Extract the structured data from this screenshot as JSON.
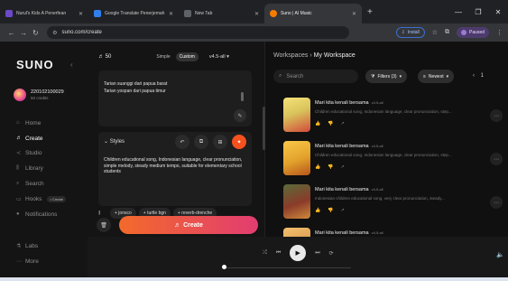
{
  "browser": {
    "tabs": [
      {
        "title": "Nurul's Kids A Penerfean",
        "fav": "#6b49c9"
      },
      {
        "title": "Google Translate Penerjemah g",
        "fav": "#2f80ed"
      },
      {
        "title": "New Tab",
        "fav": "#5f6368"
      },
      {
        "title": "Suno | AI Music",
        "fav": "#f57c00"
      }
    ],
    "new_tab": "+",
    "url": "suno.com/create",
    "install_label": "Install",
    "profile_label": "Paused"
  },
  "sidebar": {
    "logo": "SUNO",
    "user_name": "220102100029",
    "user_credits": "50 credits",
    "items": [
      {
        "label": "Home",
        "icon": "⌂"
      },
      {
        "label": "Create",
        "icon": "♬"
      },
      {
        "label": "Studio",
        "icon": "≺"
      },
      {
        "label": "Library",
        "icon": "⫼"
      },
      {
        "label": "Search",
        "icon": "⌕"
      },
      {
        "label": "Hooks",
        "icon": "▭",
        "badge": "• Create"
      },
      {
        "label": "Notifications",
        "icon": "●"
      }
    ],
    "bottom": [
      {
        "label": "Labs",
        "icon": "⚗"
      },
      {
        "label": "More",
        "icon": "⋯"
      }
    ]
  },
  "create": {
    "credits": "50",
    "mode_simple": "Simple",
    "mode_custom": "Custom",
    "version": "v4.5-all",
    "lyrics": [
      "Tarian suanggi dari papua barat",
      "Tarian yospan dari papua timur"
    ],
    "styles_label": "Styles",
    "styles_text": "Children educational song, Indonesian language, clear pronunciation, simple melody, steady medium tempo, suitable for elementary school students",
    "chips": [
      "+ jonsco",
      "+ turtle bgn",
      "+ reverb-drenche"
    ],
    "create_label": "Create"
  },
  "workspace": {
    "crumb_root": "Workspaces",
    "crumb_current": "My Workspace",
    "search_placeholder": "Search",
    "filters_label": "Filters (3)",
    "sort_label": "Newest",
    "songs": [
      {
        "title": "Mari kita kenali bersama",
        "version": "v4.5-all",
        "desc": "Children educational song, Indonesian language, clear pronunciation, step...",
        "cover": "#d9c35b"
      },
      {
        "title": "Mari kita kenali bersama",
        "version": "v4.5-all",
        "desc": "Children educational song, Indonesian language, clear pronunciation, step...",
        "cover": "#e2a12b"
      },
      {
        "title": "Mari kita kenali bersama",
        "version": "v4.5-all",
        "desc": "Indonesian children educational song, very clear pronunciation, steady...",
        "cover": "#8a3b2a"
      },
      {
        "title": "Mari kita kenali bersama",
        "version": "v4.5-all",
        "desc": "",
        "cover": "#c97a32"
      }
    ]
  }
}
